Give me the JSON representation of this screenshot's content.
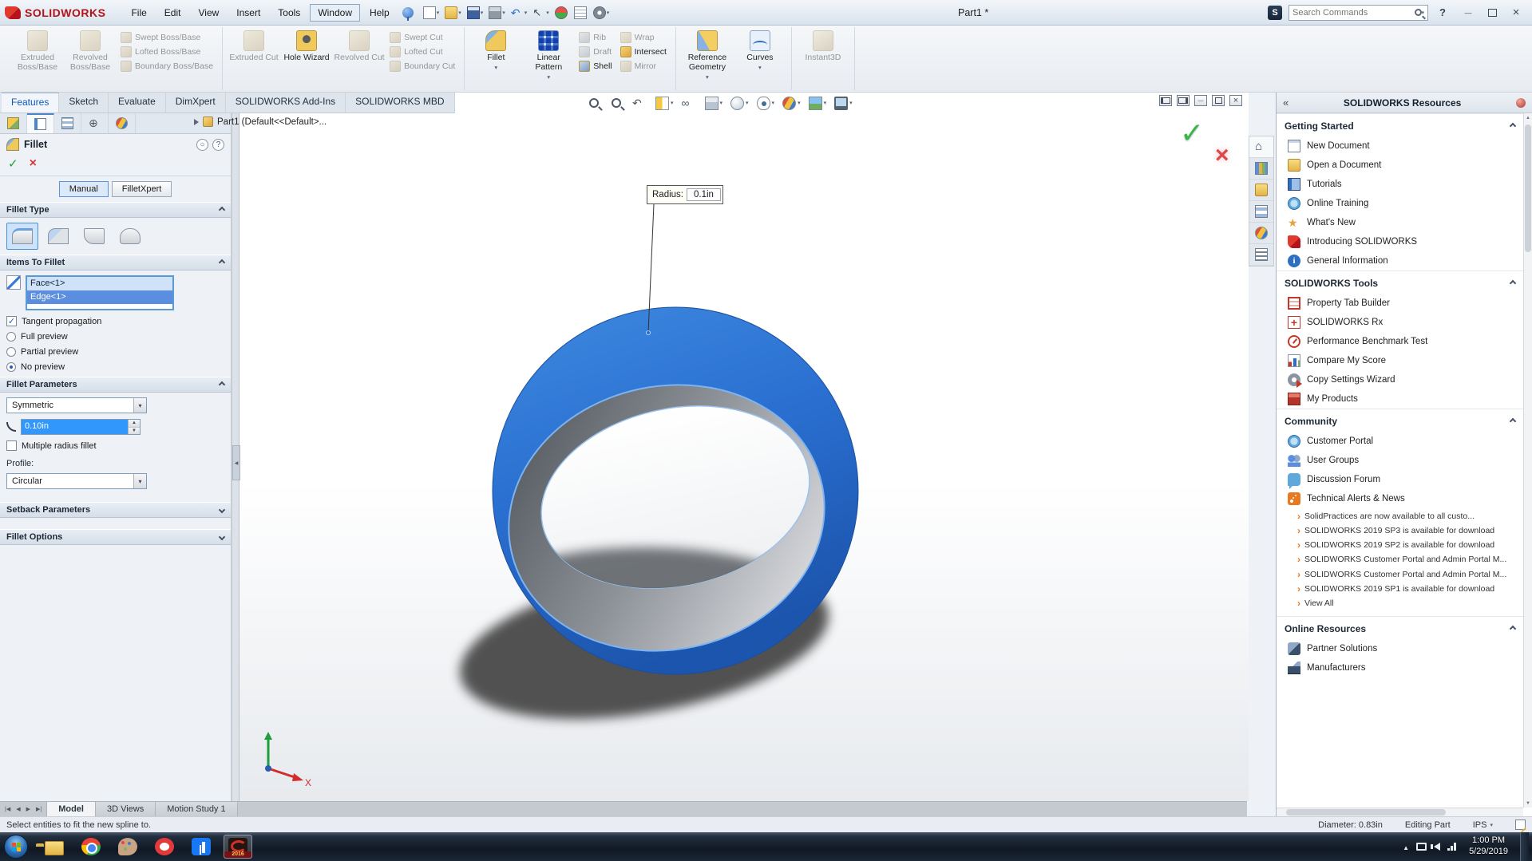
{
  "titlebar": {
    "app_name": "SOLIDWORKS",
    "menus": [
      {
        "label": "File",
        "state": ""
      },
      {
        "label": "Edit",
        "state": ""
      },
      {
        "label": "View",
        "state": ""
      },
      {
        "label": "Insert",
        "state": ""
      },
      {
        "label": "Tools",
        "state": ""
      },
      {
        "label": "Window",
        "state": "boxed"
      },
      {
        "label": "Help",
        "state": ""
      }
    ],
    "quick_access": [
      {
        "icon": "new-doc-icon",
        "arrow": "▾"
      },
      {
        "icon": "open-icon",
        "arrow": "▾"
      },
      {
        "icon": "save-icon",
        "arrow": "▾"
      },
      {
        "icon": "print-icon",
        "arrow": "▾"
      },
      {
        "icon": "undo-icon",
        "arrow": "▾"
      },
      {
        "icon": "select-icon",
        "arrow": "▾"
      },
      {
        "icon": "rebuild-icon",
        "arrow": ""
      },
      {
        "icon": "file-properties-icon",
        "arrow": ""
      },
      {
        "icon": "options-icon",
        "arrow": "▾"
      }
    ],
    "doc_title": "Part1 *",
    "search_placeholder": "Search Commands",
    "search_logo": "S"
  },
  "ribbon": {
    "g1_big": [
      {
        "label": "Extruded Boss/Base",
        "state": "disabled",
        "icon": "ri-extrude",
        "arrow": ""
      },
      {
        "label": "Revolved Boss/Base",
        "state": "disabled",
        "icon": "ri-revolve",
        "arrow": ""
      }
    ],
    "g1_small": [
      {
        "label": "Swept Boss/Base",
        "state": "disabled",
        "icon": "ri-sweep"
      },
      {
        "label": "Lofted Boss/Base",
        "state": "disabled",
        "icon": "ri-loft"
      },
      {
        "label": "Boundary Boss/Base",
        "state": "disabled",
        "icon": "ri-bound"
      }
    ],
    "g2_big": [
      {
        "label": "Extruded Cut",
        "state": "disabled",
        "icon": "ri-cutex",
        "arrow": ""
      },
      {
        "label": "Hole Wizard",
        "state": "",
        "icon": "ri-hole",
        "arrow": ""
      },
      {
        "label": "Revolved Cut",
        "state": "disabled",
        "icon": "ri-cutrev",
        "arrow": ""
      }
    ],
    "g2_small": [
      {
        "label": "Swept Cut",
        "state": "disabled",
        "icon": "ri-sweep"
      },
      {
        "label": "Lofted Cut",
        "state": "disabled",
        "icon": "ri-loft"
      },
      {
        "label": "Boundary Cut",
        "state": "disabled",
        "icon": "ri-bound"
      }
    ],
    "g3_big": [
      {
        "label": "Fillet",
        "state": "",
        "icon": "ri-fillet",
        "arrow": "▾"
      },
      {
        "label": "Linear Pattern",
        "state": "",
        "icon": "ri-pattern",
        "arrow": "▾"
      }
    ],
    "g3_small_a": [
      {
        "label": "Rib",
        "state": "disabled",
        "icon": "ri-shellx"
      },
      {
        "label": "Draft",
        "state": "disabled",
        "icon": "ri-shellx"
      },
      {
        "label": "Shell",
        "state": "",
        "icon": "ri-shellx"
      }
    ],
    "g3_small_b": [
      {
        "label": "Wrap",
        "state": "disabled",
        "icon": "ri-sweep"
      },
      {
        "label": "Intersect",
        "state": "",
        "icon": "ri-sweep"
      },
      {
        "label": "Mirror",
        "state": "disabled",
        "icon": "ri-sweep"
      }
    ],
    "g4_big": [
      {
        "label": "Reference Geometry",
        "state": "",
        "icon": "ri-refgeo",
        "arrow": "▾"
      },
      {
        "label": "Curves",
        "state": "",
        "icon": "ri-curves",
        "arrow": "▾"
      }
    ],
    "g5_big": [
      {
        "label": "Instant3D",
        "state": "disabled",
        "icon": "ri-instant",
        "arrow": ""
      }
    ]
  },
  "command_tabs": [
    {
      "label": "Features",
      "state": "active"
    },
    {
      "label": "Sketch",
      "state": ""
    },
    {
      "label": "Evaluate",
      "state": ""
    },
    {
      "label": "DimXpert",
      "state": ""
    },
    {
      "label": "SOLIDWORKS Add-Ins",
      "state": ""
    },
    {
      "label": "SOLIDWORKS MBD",
      "state": ""
    }
  ],
  "property_manager": {
    "manager_tabs": [
      {
        "icon": "feature-tree-icon",
        "state": ""
      },
      {
        "icon": "property-manager-icon",
        "state": "active"
      },
      {
        "icon": "configuration-icon",
        "state": ""
      },
      {
        "icon": "dimxpert-icon",
        "state": ""
      },
      {
        "icon": "display-manager-icon",
        "state": ""
      }
    ],
    "title": "Fillet",
    "mode_tabs": [
      {
        "label": "Manual",
        "state": "active"
      },
      {
        "label": "FilletXpert",
        "state": ""
      }
    ],
    "group_fillet_type": "Fillet Type",
    "fillet_types": [
      {
        "icon": "ft-constant",
        "state": "active"
      },
      {
        "icon": "ft-variable",
        "state": ""
      },
      {
        "icon": "ft-face",
        "state": ""
      },
      {
        "icon": "ft-full",
        "state": ""
      }
    ],
    "group_items_to_fillet": "Items To Fillet",
    "items": [
      {
        "label": "Face<1>",
        "state": "sel-light"
      },
      {
        "label": "Edge<1>",
        "state": "sel-dark"
      }
    ],
    "tangent_propagation": "Tangent propagation",
    "tangent_checked": "checked",
    "preview_options": [
      {
        "label": "Full preview",
        "checked": ""
      },
      {
        "label": "Partial preview",
        "checked": ""
      },
      {
        "label": "No preview",
        "checked": "checked"
      }
    ],
    "group_fillet_parameters": "Fillet Parameters",
    "symmetry_value": "Symmetric",
    "radius_value": "0.10in",
    "multiple_radius": "Multiple radius fillet",
    "profile_label": "Profile:",
    "profile_value": "Circular",
    "group_setback_parameters": "Setback Parameters",
    "group_fillet_options": "Fillet Options"
  },
  "viewport": {
    "tree_label": "Part1 (Default<<Default>...",
    "headsup": [
      {
        "icon": "zoom-fit-icon",
        "arrow": ""
      },
      {
        "icon": "zoom-area-icon",
        "arrow": ""
      },
      {
        "icon": "previous-view-icon",
        "arrow": ""
      },
      {
        "icon": "section-view-icon",
        "arrow": "▾"
      },
      {
        "icon": "annotation-views-icon",
        "arrow": ""
      },
      {
        "icon": "view-orientation-icon",
        "arrow": "▾"
      },
      {
        "icon": "display-style-icon",
        "arrow": "▾"
      },
      {
        "icon": "hide-show-icon",
        "arrow": "▾"
      },
      {
        "icon": "edit-appearance-icon",
        "arrow": "▾"
      },
      {
        "icon": "apply-scene-icon",
        "arrow": "▾"
      },
      {
        "icon": "view-settings-icon",
        "arrow": "▾"
      }
    ],
    "callout": {
      "label": "Radius:",
      "value": "0.1in"
    }
  },
  "taskpane": {
    "header": "SOLIDWORKS Resources",
    "side_tabs": [
      {
        "icon": "st-home",
        "state": "active"
      },
      {
        "icon": "st-library",
        "state": ""
      },
      {
        "icon": "st-explorer",
        "state": ""
      },
      {
        "icon": "st-palette",
        "state": ""
      },
      {
        "icon": "st-appearance",
        "state": ""
      },
      {
        "icon": "st-props",
        "state": ""
      }
    ],
    "sections": {
      "getting_started": {
        "title": "Getting Started",
        "items": [
          {
            "icon": "ic-newdoc",
            "label": "New Document"
          },
          {
            "icon": "ic-open",
            "label": "Open a Document"
          },
          {
            "icon": "ic-tutorials",
            "label": "Tutorials"
          },
          {
            "icon": "ic-training",
            "label": "Online Training"
          },
          {
            "icon": "ic-whatsnew",
            "label": "What's New"
          },
          {
            "icon": "ic-intro",
            "label": "Introducing SOLIDWORKS"
          },
          {
            "icon": "ic-info",
            "label": "General Information"
          }
        ]
      },
      "tools": {
        "title": "SOLIDWORKS Tools",
        "items": [
          {
            "icon": "ic-ptb",
            "label": "Property Tab Builder"
          },
          {
            "icon": "ic-rx",
            "label": "SOLIDWORKS Rx"
          },
          {
            "icon": "ic-benchmark",
            "label": "Performance Benchmark Test"
          },
          {
            "icon": "ic-compare",
            "label": "Compare My Score"
          },
          {
            "icon": "ic-copyset",
            "label": "Copy Settings Wizard"
          },
          {
            "icon": "ic-products",
            "label": "My Products"
          }
        ]
      },
      "community": {
        "title": "Community",
        "items": [
          {
            "icon": "ic-portal",
            "label": "Customer Portal"
          },
          {
            "icon": "ic-groups",
            "label": "User Groups"
          },
          {
            "icon": "ic-forum",
            "label": "Discussion Forum"
          },
          {
            "icon": "ic-rss",
            "label": "Technical Alerts & News"
          }
        ],
        "news": [
          {
            "label": "SolidPractices are now available to all custo..."
          },
          {
            "label": "SOLIDWORKS 2019 SP3 is available for download"
          },
          {
            "label": "SOLIDWORKS 2019 SP2 is available for download"
          },
          {
            "label": "SOLIDWORKS Customer Portal and Admin Portal M..."
          },
          {
            "label": "SOLIDWORKS Customer Portal and Admin Portal M..."
          },
          {
            "label": "SOLIDWORKS 2019 SP1 is available for download"
          },
          {
            "label": "View All"
          }
        ]
      },
      "online": {
        "title": "Online Resources",
        "items": [
          {
            "icon": "ic-partner",
            "label": "Partner Solutions"
          },
          {
            "icon": "ic-manufacturers",
            "label": "Manufacturers"
          }
        ]
      }
    }
  },
  "model_tabs": [
    {
      "label": "Model",
      "state": "active"
    },
    {
      "label": "3D Views",
      "state": ""
    },
    {
      "label": "Motion Study 1",
      "state": ""
    }
  ],
  "statusbar": {
    "message": "Select entities to fit the new spline to.",
    "diameter": "Diameter: 0.83in",
    "mode": "Editing Part",
    "units": "IPS"
  },
  "taskbar": {
    "icons": [
      {
        "icon": "tb-explorer",
        "state": "",
        "badge": ""
      },
      {
        "icon": "tb-chrome",
        "state": "",
        "badge": ""
      },
      {
        "icon": "tb-palette",
        "state": "",
        "badge": ""
      },
      {
        "icon": "tb-opera",
        "state": "",
        "badge": ""
      },
      {
        "icon": "tb-facebook",
        "state": "",
        "badge": ""
      },
      {
        "icon": "tb-solidworks",
        "state": "active",
        "badge": "2016"
      }
    ],
    "time": "1:00 PM",
    "date": "5/29/2019"
  }
}
